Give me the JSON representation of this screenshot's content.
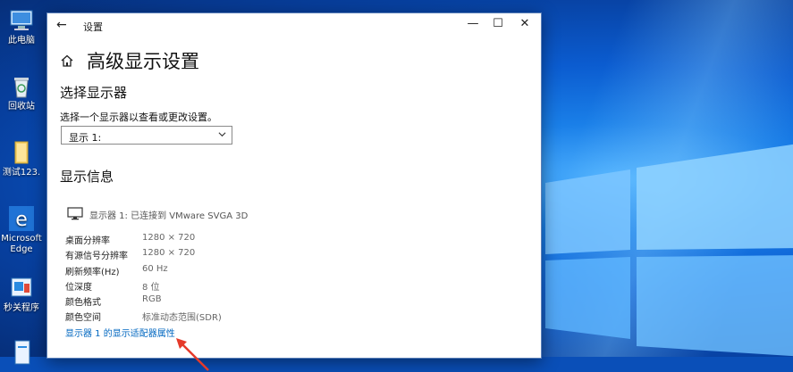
{
  "desktop": {
    "icons": [
      {
        "label": "此电脑",
        "icon": "computer-icon"
      },
      {
        "label": "回收站",
        "icon": "recycle-bin-icon"
      },
      {
        "label": "测试123.",
        "icon": "folder-icon"
      },
      {
        "label_line1": "Microsoft",
        "label_line2": "Edge",
        "icon": "edge-icon"
      },
      {
        "label": "秒关程序",
        "icon": "app-icon"
      },
      {
        "label": "",
        "icon": "file-icon"
      }
    ]
  },
  "window": {
    "title": "设置",
    "back_glyph": "←",
    "min_glyph": "—",
    "max_glyph": "☐",
    "close_glyph": "✕"
  },
  "page": {
    "title": "高级显示设置",
    "choose_section": "选择显示器",
    "choose_hint": "选择一个显示器以查看或更改设置。",
    "select_value": "显示 1:",
    "info_section": "显示信息",
    "monitor_line": "显示器 1: 已连接到 VMware SVGA 3D",
    "info_rows": [
      {
        "key": "桌面分辨率",
        "value": "1280 × 720"
      },
      {
        "key": "有源信号分辨率",
        "value": "1280 × 720"
      },
      {
        "key": "刷新频率(Hz)",
        "value": "60 Hz"
      },
      {
        "key": "位深度",
        "value": "8 位"
      },
      {
        "key": "颜色格式",
        "value": "RGB"
      },
      {
        "key": "颜色空间",
        "value": "标准动态范围(SDR)"
      }
    ],
    "adapter_link": "显示器 1 的显示适配器属性"
  },
  "colors": {
    "link": "#0067c0",
    "annotation_arrow": "#e53a2a"
  }
}
